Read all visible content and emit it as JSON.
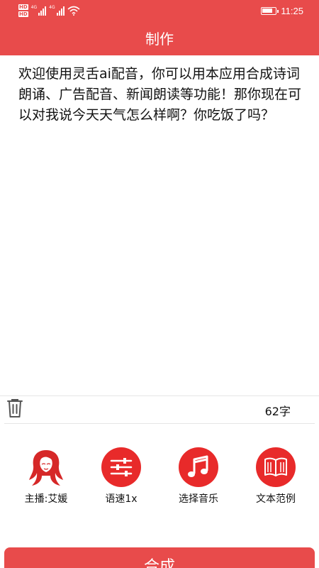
{
  "status_bar": {
    "hd1": "HD",
    "hd2": "HD",
    "sig1_tag": "4G",
    "sig2_tag": "4G",
    "battery_level": 0.85,
    "time": "11:25"
  },
  "header": {
    "title": "制作"
  },
  "editor": {
    "text": "欢迎使用灵舌ai配音，你可以用本应用合成诗词朗诵、广告配音、新闻朗读等功能！那你现在可以对我说今天天气怎么样啊？你吃饭了吗？",
    "char_count": "62字"
  },
  "tools": [
    {
      "label": "主播:艾媛",
      "icon": "anchor-avatar-icon"
    },
    {
      "label": "语速1x",
      "icon": "speed-sliders-icon"
    },
    {
      "label": "选择音乐",
      "icon": "music-note-icon"
    },
    {
      "label": "文本范例",
      "icon": "book-icon"
    }
  ],
  "compose_button": {
    "label": "合成"
  },
  "colors": {
    "primary": "#e84b4b",
    "icon_red": "#e82a2a"
  }
}
